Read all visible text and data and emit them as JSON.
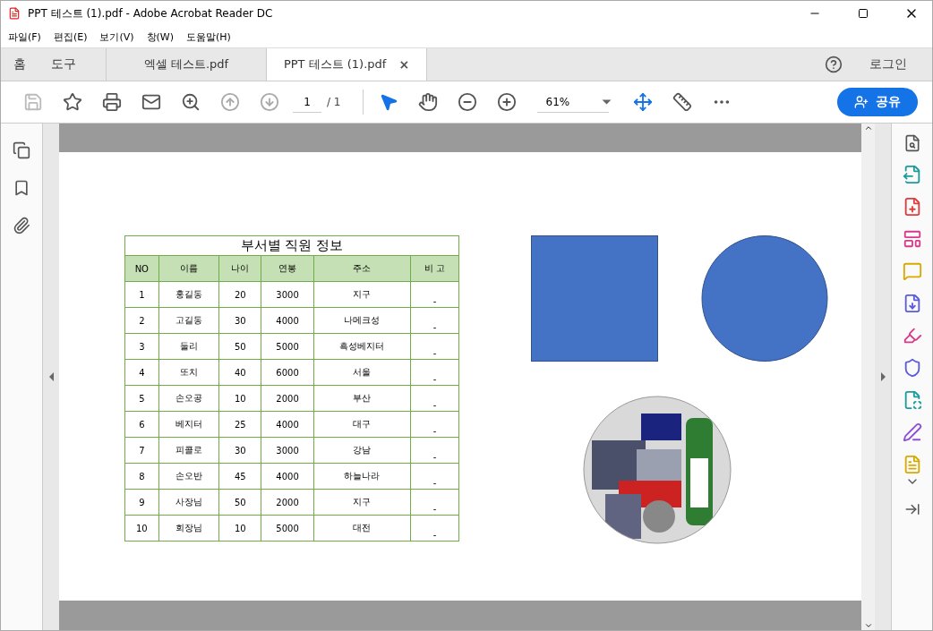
{
  "window": {
    "title": "PPT 테스트 (1).pdf - Adobe Acrobat Reader DC"
  },
  "menu": [
    "파일(F)",
    "편집(E)",
    "보기(V)",
    "창(W)",
    "도움말(H)"
  ],
  "nav": [
    "홈",
    "도구"
  ],
  "tabs": [
    {
      "label": "엑셀 테스트.pdf",
      "selected": false
    },
    {
      "label": "PPT 테스트 (1).pdf",
      "selected": true,
      "close": "×"
    }
  ],
  "header_right": {
    "login": "로그인"
  },
  "toolbar": {
    "page": "1",
    "page_total": "/ 1",
    "zoom": "61%",
    "share": "공유"
  },
  "document": {
    "table": {
      "title": "부서별 직원 정보",
      "columns": [
        "NO",
        "이름",
        "나이",
        "연봉",
        "주소",
        "비 고"
      ],
      "rows": [
        [
          "1",
          "홍길동",
          "20",
          "3000",
          "지구",
          "-"
        ],
        [
          "2",
          "고길동",
          "30",
          "4000",
          "나메크성",
          "-"
        ],
        [
          "3",
          "둘리",
          "50",
          "5000",
          "흑성베지터",
          "-"
        ],
        [
          "4",
          "또치",
          "40",
          "6000",
          "서울",
          "-"
        ],
        [
          "5",
          "손오공",
          "10",
          "2000",
          "부산",
          "-"
        ],
        [
          "6",
          "베지터",
          "25",
          "4000",
          "대구",
          "-"
        ],
        [
          "7",
          "피콜로",
          "30",
          "3000",
          "강남",
          "-"
        ],
        [
          "8",
          "손오반",
          "45",
          "4000",
          "하늘나라",
          "-"
        ],
        [
          "9",
          "사장님",
          "50",
          "2000",
          "지구",
          "-"
        ],
        [
          "10",
          "회장님",
          "10",
          "5000",
          "대전",
          "-"
        ]
      ]
    },
    "shapes": [
      {
        "kind": "square",
        "color": "#4472c4"
      },
      {
        "kind": "circle",
        "color": "#4472c4"
      }
    ]
  }
}
